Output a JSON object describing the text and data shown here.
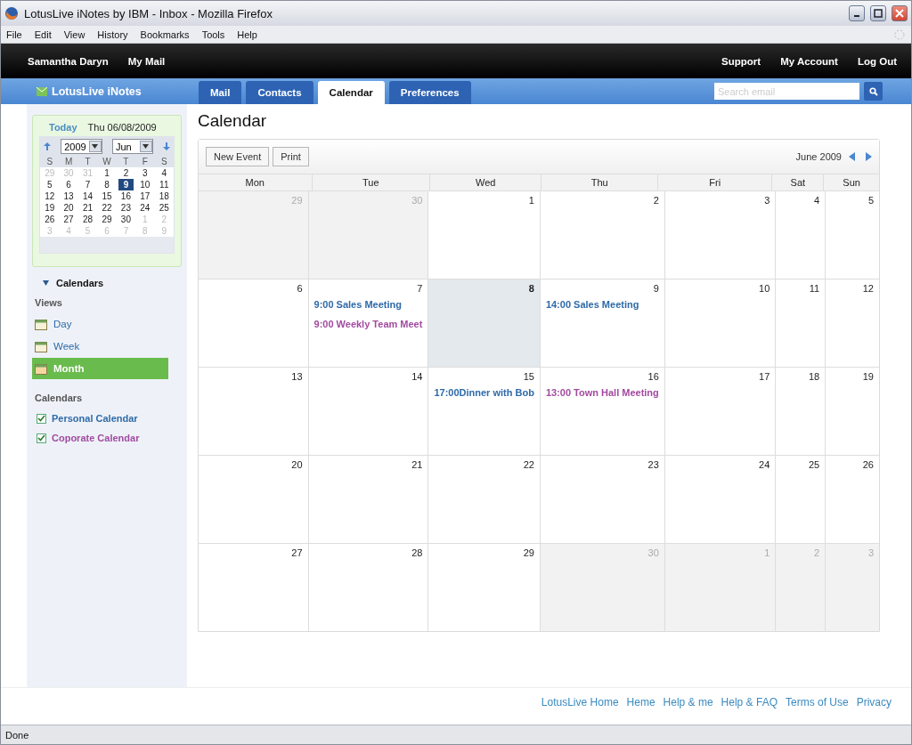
{
  "window": {
    "title": "LotusLive iNotes by IBM - Inbox - Mozilla Firefox"
  },
  "menu": [
    "File",
    "Edit",
    "View",
    "History",
    "Bookmarks",
    "Tools",
    "Help"
  ],
  "topbar": {
    "user": "Samantha Daryn",
    "left_links": [
      "My Mail"
    ],
    "right_links": [
      "Support",
      "My Account",
      "Log Out"
    ]
  },
  "brand": "LotusLive iNotes",
  "tabs": [
    {
      "label": "Mail",
      "selected": false
    },
    {
      "label": "Contacts",
      "selected": false
    },
    {
      "label": "Calendar",
      "selected": true
    },
    {
      "label": "Preferences",
      "selected": false
    }
  ],
  "search": {
    "placeholder": "Search email"
  },
  "mini_calendar": {
    "today_link": "Today",
    "date": "Thu 06/08/2009",
    "year": "2009",
    "month": "Jun",
    "weekdays": [
      "S",
      "M",
      "T",
      "W",
      "T",
      "F",
      "S"
    ],
    "weeks": [
      [
        {
          "day": "29",
          "outside": true,
          "selected": false
        },
        {
          "day": "30",
          "outside": true,
          "selected": false
        },
        {
          "day": "31",
          "outside": true,
          "selected": false
        },
        {
          "day": "1",
          "outside": false,
          "selected": false
        },
        {
          "day": "2",
          "outside": false,
          "selected": false
        },
        {
          "day": "3",
          "outside": false,
          "selected": false
        },
        {
          "day": "4",
          "outside": false,
          "selected": false
        }
      ],
      [
        {
          "day": "5",
          "outside": false,
          "selected": false
        },
        {
          "day": "6",
          "outside": false,
          "selected": false
        },
        {
          "day": "7",
          "outside": false,
          "selected": false
        },
        {
          "day": "8",
          "outside": false,
          "selected": false
        },
        {
          "day": "9",
          "outside": false,
          "selected": true
        },
        {
          "day": "10",
          "outside": false,
          "selected": false
        },
        {
          "day": "11",
          "outside": false,
          "selected": false
        }
      ],
      [
        {
          "day": "12",
          "outside": false,
          "selected": false
        },
        {
          "day": "13",
          "outside": false,
          "selected": false
        },
        {
          "day": "14",
          "outside": false,
          "selected": false
        },
        {
          "day": "15",
          "outside": false,
          "selected": false
        },
        {
          "day": "16",
          "outside": false,
          "selected": false
        },
        {
          "day": "17",
          "outside": false,
          "selected": false
        },
        {
          "day": "18",
          "outside": false,
          "selected": false
        }
      ],
      [
        {
          "day": "19",
          "outside": false,
          "selected": false
        },
        {
          "day": "20",
          "outside": false,
          "selected": false
        },
        {
          "day": "21",
          "outside": false,
          "selected": false
        },
        {
          "day": "22",
          "outside": false,
          "selected": false
        },
        {
          "day": "23",
          "outside": false,
          "selected": false
        },
        {
          "day": "24",
          "outside": false,
          "selected": false
        },
        {
          "day": "25",
          "outside": false,
          "selected": false
        }
      ],
      [
        {
          "day": "26",
          "outside": false,
          "selected": false
        },
        {
          "day": "27",
          "outside": false,
          "selected": false
        },
        {
          "day": "28",
          "outside": false,
          "selected": false
        },
        {
          "day": "29",
          "outside": false,
          "selected": false
        },
        {
          "day": "30",
          "outside": false,
          "selected": false
        },
        {
          "day": "1",
          "outside": true,
          "selected": false
        },
        {
          "day": "2",
          "outside": true,
          "selected": false
        }
      ],
      [
        {
          "day": "3",
          "outside": true,
          "selected": false
        },
        {
          "day": "4",
          "outside": true,
          "selected": false
        },
        {
          "day": "5",
          "outside": true,
          "selected": false
        },
        {
          "day": "6",
          "outside": true,
          "selected": false
        },
        {
          "day": "7",
          "outside": true,
          "selected": false
        },
        {
          "day": "8",
          "outside": true,
          "selected": false
        },
        {
          "day": "9",
          "outside": true,
          "selected": false
        }
      ]
    ]
  },
  "sidebar": {
    "section_title": "Calendars",
    "expanded": true,
    "views_label": "Views",
    "views": [
      {
        "label": "Day",
        "selected": false
      },
      {
        "label": "Week",
        "selected": false
      },
      {
        "label": "Month",
        "selected": true
      }
    ],
    "calendars_label": "Calendars",
    "calendars": [
      {
        "label": "Personal Calendar",
        "checked": true,
        "color": "#2e6aa8"
      },
      {
        "label": "Coporate Calendar",
        "checked": true,
        "color": "#a24aa0"
      }
    ]
  },
  "calendar": {
    "title": "Calendar",
    "buttons": [
      "New Event",
      "Print"
    ],
    "month_label": "June 2009",
    "columns": [
      "Mon",
      "Tue",
      "Wed",
      "Thu",
      "Fri",
      "Sat",
      "Sun"
    ],
    "weeks": [
      [
        {
          "day": "29",
          "outside": true,
          "today": false
        },
        {
          "day": "30",
          "outside": true,
          "today": false
        },
        {
          "day": "1",
          "outside": false,
          "today": false
        },
        {
          "day": "2",
          "outside": false,
          "today": false
        },
        {
          "day": "3",
          "outside": false,
          "today": false
        },
        {
          "day": "4",
          "outside": false,
          "today": false
        },
        {
          "day": "5",
          "outside": false,
          "today": false
        }
      ],
      [
        {
          "day": "6",
          "outside": false,
          "today": false
        },
        {
          "day": "7",
          "outside": false,
          "today": false,
          "events": [
            {
              "text": "9:00 Sales Meeting",
              "color": "#2e6aa8"
            },
            {
              "text": "9:00 Weekly Team Meet",
              "color": "#a24aa0"
            }
          ]
        },
        {
          "day": "8",
          "outside": false,
          "today": true
        },
        {
          "day": "9",
          "outside": false,
          "today": false,
          "events": [
            {
              "text": "14:00 Sales Meeting",
              "color": "#2e6aa8"
            }
          ]
        },
        {
          "day": "10",
          "outside": false,
          "today": false
        },
        {
          "day": "11",
          "outside": false,
          "today": false
        },
        {
          "day": "12",
          "outside": false,
          "today": false
        }
      ],
      [
        {
          "day": "13",
          "outside": false,
          "today": false
        },
        {
          "day": "14",
          "outside": false,
          "today": false
        },
        {
          "day": "15",
          "outside": false,
          "today": false,
          "events": [
            {
              "text": "17:00Dinner with Bob",
              "color": "#2e6aa8"
            }
          ]
        },
        {
          "day": "16",
          "outside": false,
          "today": false,
          "events": [
            {
              "text": "13:00 Town Hall Meeting",
              "color": "#a24aa0"
            }
          ]
        },
        {
          "day": "17",
          "outside": false,
          "today": false
        },
        {
          "day": "18",
          "outside": false,
          "today": false
        },
        {
          "day": "19",
          "outside": false,
          "today": false
        }
      ],
      [
        {
          "day": "20",
          "outside": false,
          "today": false
        },
        {
          "day": "21",
          "outside": false,
          "today": false
        },
        {
          "day": "22",
          "outside": false,
          "today": false
        },
        {
          "day": "23",
          "outside": false,
          "today": false
        },
        {
          "day": "24",
          "outside": false,
          "today": false
        },
        {
          "day": "25",
          "outside": false,
          "today": false
        },
        {
          "day": "26",
          "outside": false,
          "today": false
        }
      ],
      [
        {
          "day": "27",
          "outside": false,
          "today": false
        },
        {
          "day": "28",
          "outside": false,
          "today": false
        },
        {
          "day": "29",
          "outside": false,
          "today": false
        },
        {
          "day": "30",
          "outside": true,
          "today": false
        },
        {
          "day": "1",
          "outside": true,
          "today": false
        },
        {
          "day": "2",
          "outside": true,
          "today": false
        },
        {
          "day": "3",
          "outside": true,
          "today": false
        }
      ]
    ]
  },
  "footer_links": [
    "LotusLive Home",
    "Heme",
    "Help & me",
    "Help & FAQ",
    "Terms of Use",
    "Privacy"
  ],
  "status_bar": "Done"
}
